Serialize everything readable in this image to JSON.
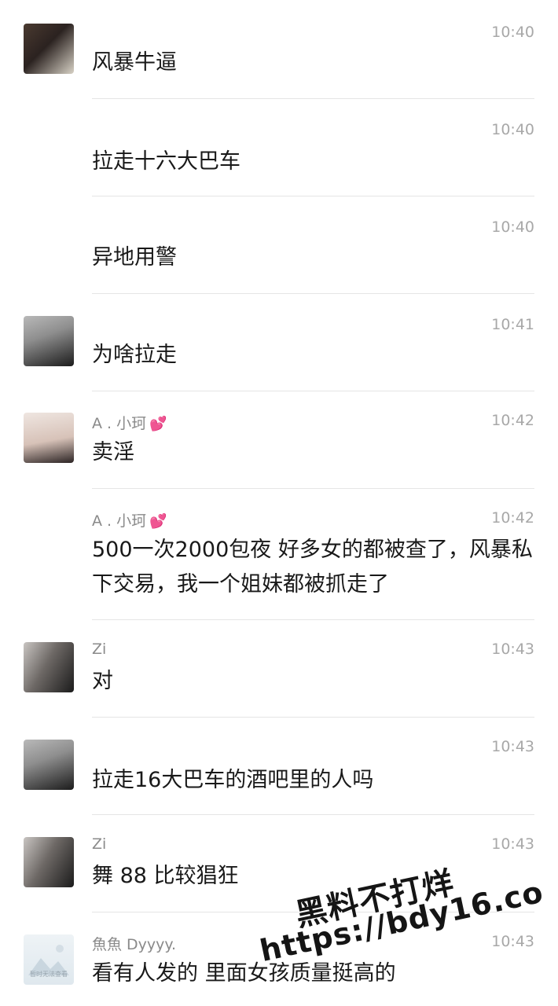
{
  "messages": [
    {
      "sender": "",
      "time": "10:40",
      "text": "风暴牛逼"
    },
    {
      "sender": "",
      "time": "10:40",
      "text": "拉走十六大巴车"
    },
    {
      "sender": "",
      "time": "10:40",
      "text": "异地用警"
    },
    {
      "sender": "",
      "time": "10:41",
      "text": "为啥拉走"
    },
    {
      "sender": "A . 小珂",
      "time": "10:42",
      "text": "卖淫"
    },
    {
      "sender": "A . 小珂",
      "time": "10:42",
      "text": "500一次2000包夜 好多女的都被查了，风暴私下交易，我一个姐妹都被抓走了"
    },
    {
      "sender": "Zi",
      "time": "10:43",
      "text": "对"
    },
    {
      "sender": "",
      "time": "10:43",
      "text": "拉走16大巴车的酒吧里的人吗"
    },
    {
      "sender": "Zi",
      "time": "10:43",
      "text": "舞 88 比较猖狂"
    },
    {
      "sender": "魚魚 Dyyyy.",
      "time": "10:43",
      "text": "看有人发的 里面女孩质量挺高的"
    }
  ],
  "avatar_placeholder_text": "暂时无法查看",
  "watermark": {
    "line1": "黑料不打烊",
    "line2": "https://bdy16.co"
  }
}
